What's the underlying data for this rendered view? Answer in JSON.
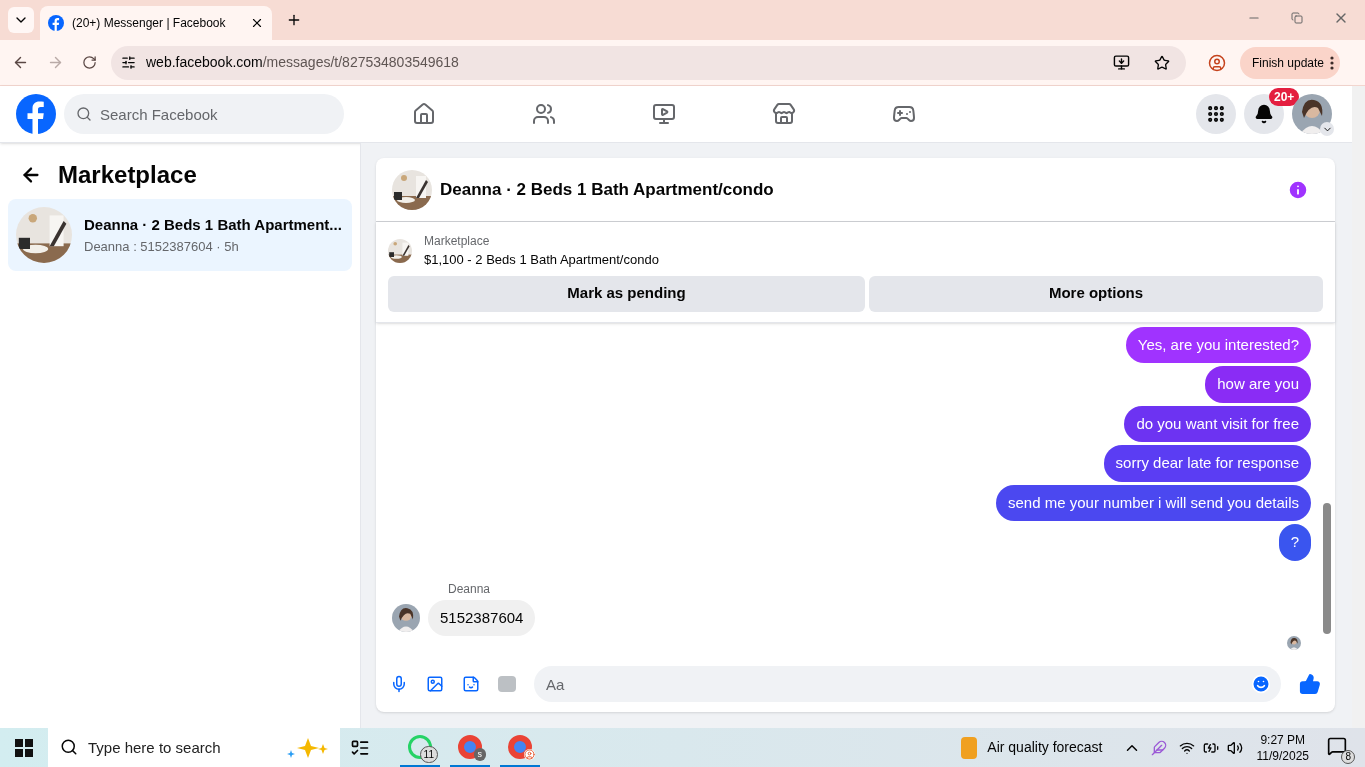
{
  "browser": {
    "tabs": [
      {
        "title": "(20+) Messenger | Facebook",
        "selected": true
      }
    ],
    "url_host": "web.facebook.com",
    "url_path": "/messages/t/827534803549618",
    "update_button": "Finish update"
  },
  "facebook_header": {
    "search": {
      "placeholder": "Search Facebook"
    },
    "notification_badge": "20+"
  },
  "sidebar": {
    "title": "Marketplace",
    "conversations": [
      {
        "title": "Deanna · 2 Beds 1 Bath Apartment...",
        "subtitle": "Deanna : 5152387604 · 5h",
        "selected": true
      }
    ]
  },
  "chat": {
    "title": "Deanna · 2 Beds 1 Bath Apartment/condo",
    "listing": {
      "label": "Marketplace",
      "title": "$1,100 - 2 Beds 1 Bath Apartment/condo"
    },
    "actions": [
      "Mark as pending",
      "More options"
    ],
    "messages": [
      {
        "kind": "sent",
        "text": "Yes, are you interested?"
      },
      {
        "kind": "sent",
        "text": "how are you"
      },
      {
        "kind": "sent",
        "text": "do you want visit for free"
      },
      {
        "kind": "sent",
        "text": "sorry dear late for response"
      },
      {
        "kind": "sent",
        "text": "send me your number i will send you details"
      },
      {
        "kind": "sent",
        "text": "?"
      },
      {
        "kind": "received",
        "sender": "Deanna",
        "text": "5152387604"
      }
    ],
    "composer": {
      "placeholder": "Aa"
    }
  },
  "taskbar": {
    "search": {
      "placeholder": "Type here to search"
    },
    "whatsapp_badge": "11",
    "chrome_badge": "s",
    "weather": "Air quality forecast",
    "time": "9:27 PM",
    "date": "11/9/2025",
    "notifications": "8"
  }
}
